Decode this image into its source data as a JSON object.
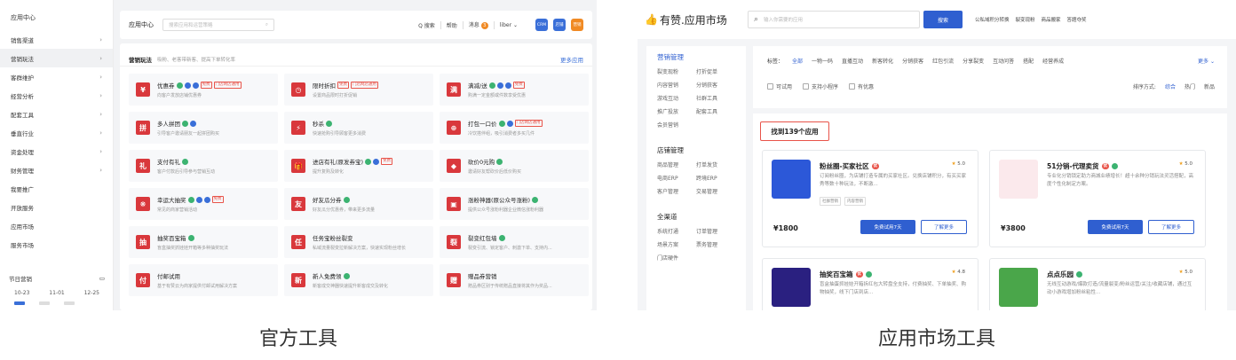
{
  "left": {
    "sidebar_title": "应用中心",
    "menu": [
      {
        "label": "销售渠道",
        "arrow": true,
        "active": false
      },
      {
        "label": "营销玩法",
        "arrow": true,
        "active": true
      },
      {
        "label": "客群维护",
        "arrow": true,
        "active": false
      },
      {
        "label": "经营分析",
        "arrow": true,
        "active": false
      },
      {
        "label": "配套工具",
        "arrow": true,
        "active": false
      },
      {
        "label": "垂直行业",
        "arrow": true,
        "active": false
      },
      {
        "label": "资金处理",
        "arrow": true,
        "active": false
      },
      {
        "label": "财务管理",
        "arrow": true,
        "active": false
      },
      {
        "label": "我要推广",
        "arrow": false,
        "active": false
      },
      {
        "label": "开放服务",
        "arrow": false,
        "active": false
      },
      {
        "label": "应用市场",
        "arrow": false,
        "active": false
      },
      {
        "label": "服务市场",
        "arrow": false,
        "active": false
      }
    ],
    "festival": {
      "title": "节日营销",
      "dates": [
        "10-23",
        "11-01",
        "12-25"
      ]
    },
    "topbar": {
      "title": "应用中心",
      "search_placeholder": "搜索应用和运营策略",
      "search": "Q 搜索",
      "help": "帮助",
      "messages": "消息",
      "message_count": "3",
      "user": "liber",
      "icons": [
        {
          "name": "crm-icon",
          "label": "CRM",
          "color": "#3a6fd8"
        },
        {
          "name": "store-icon",
          "label": "店铺",
          "color": "#3a6fd8"
        },
        {
          "name": "app-icon",
          "label": "营销",
          "color": "#f08a24"
        }
      ]
    },
    "section": {
      "title": "营销玩法",
      "subtitle": "吸粉、老客带新客、提高下单转化率",
      "more": "更多应用"
    },
    "apps": [
      {
        "icon": "coupon-icon",
        "glyph": "¥",
        "name": "优惠券",
        "badges": [
          "g",
          "b",
          "b"
        ],
        "tags": [
          "免费",
          "门店网店通用"
        ],
        "desc": "向客户发放店铺优惠券"
      },
      {
        "icon": "timer-icon",
        "glyph": "◷",
        "name": "限时折扣",
        "badges": [],
        "tags": [
          "免费",
          "门店网店通用"
        ],
        "desc": "设置商品限时打折促销"
      },
      {
        "icon": "full-reduce-icon",
        "glyph": "满",
        "name": "满减/送",
        "badges": [
          "g",
          "b",
          "b"
        ],
        "tags": [
          "免费"
        ],
        "desc": "购满一定金额或件数享受优惠"
      },
      {
        "icon": "group-buy-icon",
        "glyph": "拼",
        "name": "多人拼团",
        "badges": [
          "g",
          "b"
        ],
        "tags": [],
        "desc": "引导客户邀请朋友一起拼团购买"
      },
      {
        "icon": "flash-sale-icon",
        "glyph": "⚡",
        "name": "秒杀",
        "badges": [
          "g"
        ],
        "tags": [],
        "desc": "快速抢购引导顾客更多消费"
      },
      {
        "icon": "bundle-price-icon",
        "glyph": "⊕",
        "name": "打包一口价",
        "badges": [
          "g",
          "b"
        ],
        "tags": [
          "门店网店通用"
        ],
        "desc": "冷饮搭伴组，吸引消费者多买几件"
      },
      {
        "icon": "gift-icon",
        "glyph": "礼",
        "name": "支付有礼",
        "badges": [
          "g"
        ],
        "tags": [],
        "desc": "客户付款后引导参与营销互动"
      },
      {
        "icon": "enter-gift-icon",
        "glyph": "🎁",
        "name": "进店有礼(原发券宝)",
        "badges": [
          "g",
          "b"
        ],
        "tags": [
          "免费"
        ],
        "desc": "提升复购及转化"
      },
      {
        "icon": "bargain-icon",
        "glyph": "◆",
        "name": "砍价0元购",
        "badges": [
          "g"
        ],
        "tags": [],
        "desc": "邀请好友帮砍价后低价购买"
      },
      {
        "icon": "lottery-icon",
        "glyph": "❋",
        "name": "幸运大抽奖",
        "badges": [
          "g",
          "b",
          "b"
        ],
        "tags": [
          "免费"
        ],
        "desc": "常见的商家营销活动"
      },
      {
        "icon": "share-icon",
        "glyph": "友",
        "name": "好友瓜分券",
        "badges": [
          "g"
        ],
        "tags": [],
        "desc": "好友瓜分优惠券，带来更多流量"
      },
      {
        "icon": "fans-icon",
        "glyph": "▣",
        "name": "涨粉神器(原公众号涨粉)",
        "badges": [
          "g"
        ],
        "tags": [],
        "desc": "提供公众号涨粉利器企业微信涨粉利器"
      },
      {
        "icon": "prize-box-icon",
        "glyph": "抽",
        "name": "抽奖百宝箱",
        "badges": [
          "g"
        ],
        "tags": [],
        "desc": "盲盒抽奖抓娃娃开箱等多种抽奖玩法"
      },
      {
        "icon": "task-icon",
        "glyph": "任",
        "name": "任务宝粉丝裂变",
        "badges": [],
        "tags": [],
        "desc": "私域流量裂变拉新解决方案，快速实现粉丝增长"
      },
      {
        "icon": "fission-icon",
        "glyph": "裂",
        "name": "裂变红包墙",
        "badges": [
          "g"
        ],
        "tags": [],
        "desc": "裂变引流、锁定客户、刺激下单、支持内..."
      },
      {
        "icon": "paid-trial-icon",
        "glyph": "付",
        "name": "付邮试用",
        "badges": [],
        "tags": [],
        "desc": "基于有赞云为商家提供付邮试用解决方案"
      },
      {
        "icon": "new-user-icon",
        "glyph": "新",
        "name": "新人免费领",
        "badges": [
          "g"
        ],
        "tags": [],
        "desc": "新客成交神器快速提升新客成交及转化"
      },
      {
        "icon": "present-coupon-icon",
        "glyph": "赠",
        "name": "赠品券营销",
        "badges": [],
        "tags": [],
        "desc": "赠品券区别于传统赠品直接将其作为奖品..."
      }
    ]
  },
  "right": {
    "logo": "有赞.应用市场",
    "search_placeholder": "输入你需要的应用",
    "search_button": "搜索",
    "top_links": [
      "公私域积分转换",
      "裂变现粉",
      "商品搬家",
      "答题夺奖"
    ],
    "sidebar": [
      {
        "title": "营销管理",
        "active": true,
        "items": [
          "裂变现粉",
          "打折促单",
          "内容营销",
          "分销获客",
          "游戏互动",
          "社群工具",
          "推广投放",
          "配套工具",
          "会员营销"
        ]
      },
      {
        "title": "店铺管理",
        "active": false,
        "items": [
          "商品管理",
          "打单发货",
          "电商ERP",
          "跨境ERP",
          "客户管理",
          "交易管理"
        ]
      },
      {
        "title": "全渠道",
        "active": false,
        "items": [
          "系统打通",
          "订单管理",
          "场景方案",
          "票务管理",
          "门店硬件"
        ]
      }
    ],
    "filter": {
      "label": "标签：",
      "tags": [
        "全部",
        "一物一码",
        "直播互动",
        "新客转化",
        "分销获客",
        "红包引流",
        "分享裂变",
        "互动问答",
        "搭配",
        "经营养成"
      ],
      "more": "更多",
      "checks": [
        "可试用",
        "支持小程序",
        "有优惠"
      ],
      "sort_label": "排序方式:",
      "sorts": [
        "综合",
        "热门",
        "新品"
      ]
    },
    "found": "找到139个应用",
    "cards": [
      {
        "icon": "fans-circle-icon",
        "pic_color": "#2c58d8",
        "name": "粉丝圈-买家社区",
        "pill": "优",
        "check": false,
        "rating": "5.0",
        "desc": "订阅粉丝圈，为店铺打造专属的买家社区。兑换店铺积分，有买买家秀等数十种玩法，不断激...",
        "tags": [
          "社群营销",
          "内容营销"
        ],
        "price": "¥1800",
        "try": "免费试用7天",
        "more": "了解更多"
      },
      {
        "icon": "distribution-icon",
        "pic_color": "#fbe9ec",
        "name": "51分销-代理卖货",
        "pill": "优",
        "check": true,
        "rating": "5.0",
        "desc": "专业化分销锁定助力商城业绩增长！超十余种分销玩法灵活搭配，高度个性化制定方案。",
        "tags": [],
        "price": "¥3800",
        "try": "免费试用7天",
        "more": "了解更多"
      },
      {
        "icon": "prize-box-icon",
        "pic_color": "#2a2080",
        "name": "抽奖百宝箱",
        "pill": "优",
        "check": true,
        "rating": "4.8",
        "desc": "盲盒抽蛋抓娃娃开箱拆红包大转盘全支持，付费抽奖、下单抽奖、购物抽奖，线下门店到店...",
        "tags": [],
        "price": "",
        "try": "",
        "more": ""
      },
      {
        "icon": "fun-park-icon",
        "pic_color": "#4aa64a",
        "name": "点点乐园",
        "pill": "",
        "check": true,
        "rating": "5.0",
        "desc": "无线互动游戏/爆款打造/流量裂变/粉丝运营/关注/收藏店铺，通过互动小游戏增加粉丝粘性...",
        "tags": [],
        "price": "",
        "try": "",
        "more": ""
      }
    ]
  },
  "captions": {
    "left": "官方工具",
    "right": "应用市场工具"
  }
}
